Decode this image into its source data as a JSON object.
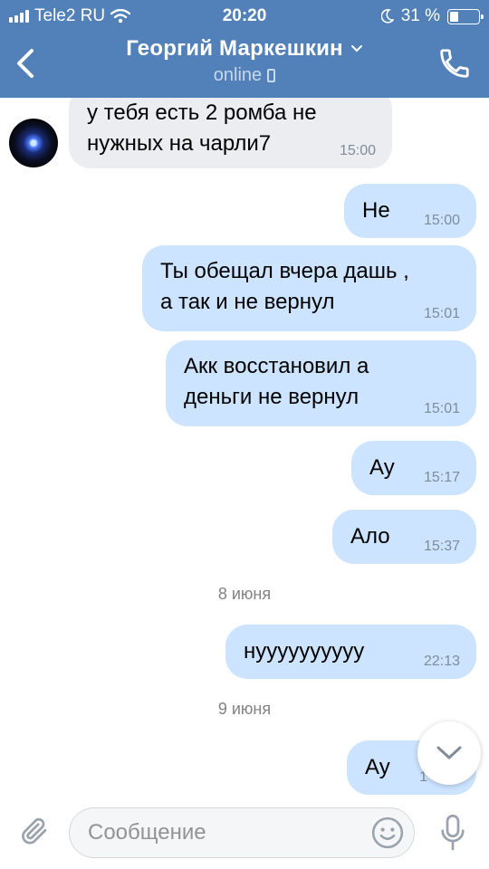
{
  "status_bar": {
    "carrier": "Tele2 RU",
    "time": "20:20",
    "battery": "31 %",
    "battery_level": 0.31
  },
  "header": {
    "contact_name": "Георгий Маркешкин",
    "status": "online",
    "accent_color": "#5181b8"
  },
  "messages": [
    {
      "direction": "in",
      "text": "у тебя есть 2 ромба не\nнужных на чарли7",
      "time": "15:00"
    },
    {
      "direction": "out",
      "text": "Не",
      "time": "15:00"
    },
    {
      "direction": "out",
      "text": "Ты обещал вчера дашь ,\nа так и не вернул",
      "time": "15:01"
    },
    {
      "direction": "out",
      "text": "Акк восстановил а\nденьги не вернул",
      "time": "15:01"
    },
    {
      "direction": "out",
      "text": "Ау",
      "time": "15:17"
    },
    {
      "direction": "out",
      "text": "Ало",
      "time": "15:37"
    },
    {
      "type": "date",
      "label": "8 июня"
    },
    {
      "direction": "out",
      "text": "нуууууууууу",
      "time": "22:13"
    },
    {
      "type": "date",
      "label": "9 июня"
    },
    {
      "direction": "out",
      "text": "Ау",
      "time": "1"
    }
  ],
  "composer": {
    "placeholder": "Сообщение"
  },
  "icons": {
    "back": "chevron-left-icon",
    "call": "phone-icon",
    "attach": "paperclip-icon",
    "emoji": "smile-icon",
    "mic": "microphone-icon",
    "scroll": "chevron-down-icon"
  }
}
